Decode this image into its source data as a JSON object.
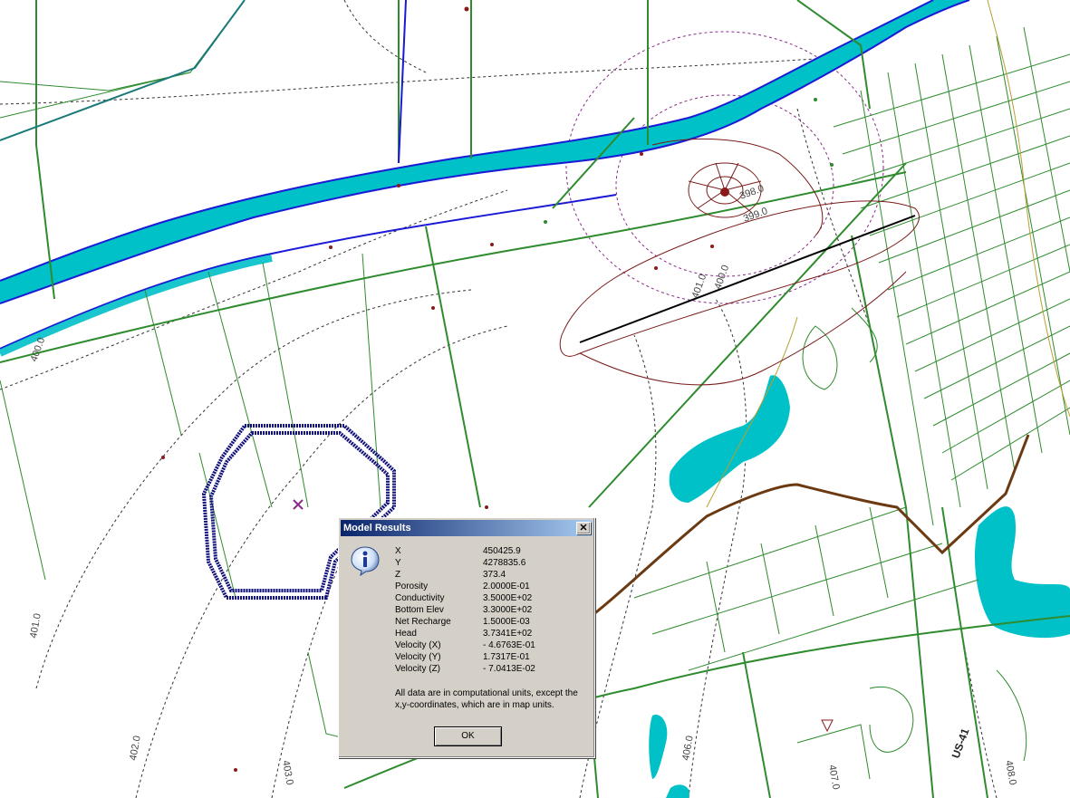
{
  "map": {
    "contour_labels": [
      "400.0",
      "401.0",
      "402.0",
      "403.0",
      "406.0",
      "407.0",
      "408.0",
      "400.0",
      "401.0",
      "399.0",
      "398.0"
    ],
    "road_label": "US-41",
    "colors": {
      "river": "#00c0c8",
      "river_edge": "#1a1ad6",
      "roads": "#2e8b2e",
      "contours": "#333333",
      "well_contours": "#7a1a1a",
      "rail": "#6b3a12"
    }
  },
  "dialog": {
    "title": "Model Results",
    "close_label": "✕",
    "icon": "info-icon",
    "rows": [
      {
        "label": "X",
        "value": "450425.9"
      },
      {
        "label": "Y",
        "value": "4278835.6"
      },
      {
        "label": "Z",
        "value": "373.4"
      },
      {
        "label": "Porosity",
        "value": " 2.0000E-01"
      },
      {
        "label": "Conductivity",
        "value": " 3.5000E+02"
      },
      {
        "label": "Bottom Elev",
        "value": " 3.3000E+02"
      },
      {
        "label": "Net Recharge",
        "value": " 1.5000E-03"
      },
      {
        "label": "Head",
        "value": " 3.7341E+02"
      },
      {
        "label": "Velocity (X)",
        "value": "- 4.6763E-01"
      },
      {
        "label": "Velocity (Y)",
        "value": " 1.7317E-01"
      },
      {
        "label": "Velocity (Z)",
        "value": "- 7.0413E-02"
      }
    ],
    "note": "All data are in computational units, except the x,y-coordinates, which are in map units.",
    "ok_label": "OK"
  }
}
